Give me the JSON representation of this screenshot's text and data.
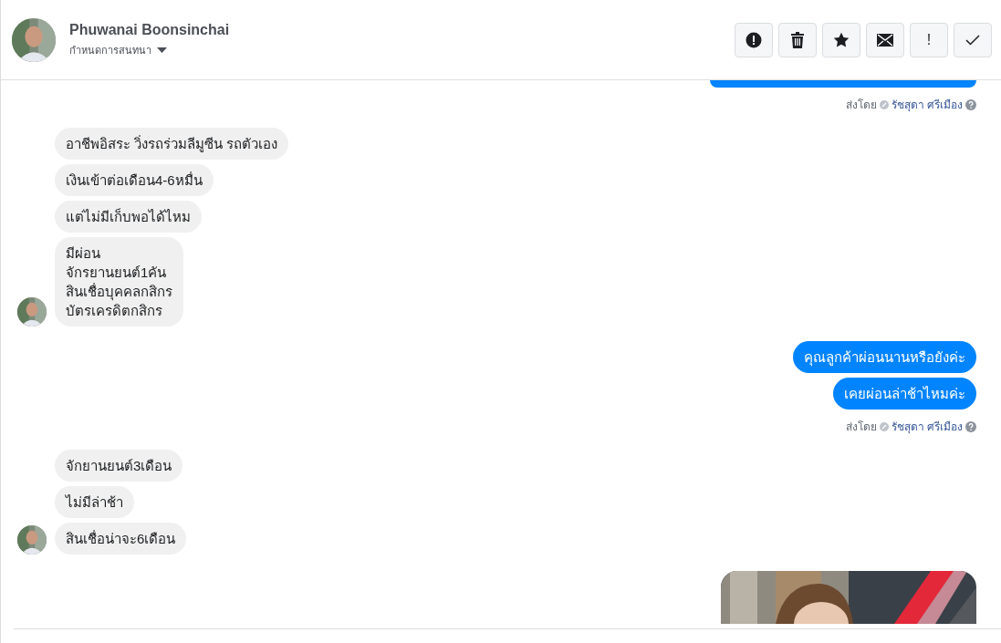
{
  "header": {
    "name": "Phuwanai Boonsinchai",
    "subtitle": "กำหนดการสนทนา",
    "actions": [
      {
        "kind": "alert"
      },
      {
        "kind": "trash"
      },
      {
        "kind": "star"
      },
      {
        "kind": "mail"
      },
      {
        "kind": "exclaim",
        "label": "!"
      },
      {
        "kind": "check"
      }
    ]
  },
  "groups": [
    {
      "kind": "sent",
      "bubbles": [
        {
          "kind": "cut"
        }
      ],
      "note": {
        "prefix": "ส่งโดย",
        "sender": "รัชสุดา ศรีเมือง"
      }
    },
    {
      "kind": "received",
      "bubbles": [
        {
          "kind": "text",
          "text": "อาชีพอิสระ วิ่งรถร่วมลีมูซีน รถตัวเอง"
        },
        {
          "kind": "text",
          "text": "เงินเข้าต่อเดือน4-6หมื่น"
        },
        {
          "kind": "text",
          "text": "แต่ไม่มีเก็บพอได้ไหม"
        },
        {
          "kind": "text",
          "text": "มีผ่อน\nจักรยานยนต์1คัน\nสินเชื่อบุคคลกสิกร\nบัตรเครดิตกสิกร"
        }
      ]
    },
    {
      "kind": "sent",
      "bubbles": [
        {
          "kind": "text",
          "text": "คุณลูกค้าผ่อนนานหรือยังค่ะ"
        },
        {
          "kind": "text",
          "text": "เคยผ่อนล่าช้าไหมค่ะ"
        }
      ],
      "note": {
        "prefix": "ส่งโดย",
        "sender": "รัชสุดา ศรีเมือง"
      }
    },
    {
      "kind": "received",
      "bubbles": [
        {
          "kind": "text",
          "text": "จักยานยนต์3เดือน"
        },
        {
          "kind": "text",
          "text": "ไม่มีล่าช้า"
        },
        {
          "kind": "text",
          "text": "สินเชื่อน่าจะ6เดือน"
        }
      ]
    },
    {
      "kind": "sent"
    }
  ]
}
